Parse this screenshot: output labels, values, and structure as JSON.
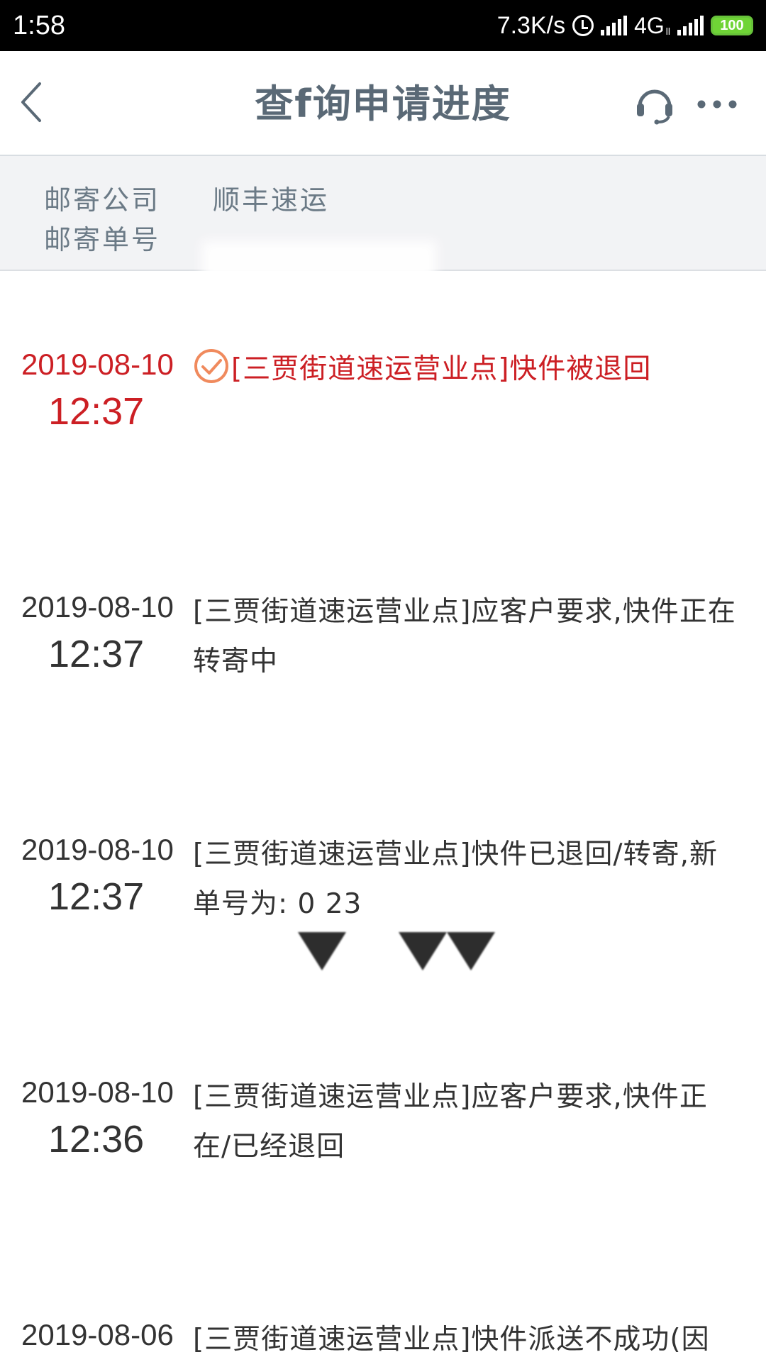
{
  "status_bar": {
    "time": "1:58",
    "net_speed": "7.3K/s",
    "network": "4G",
    "network_sub": "ll",
    "battery": "100",
    "icons": [
      "alarm-icon",
      "signal-icon",
      "signal-icon",
      "battery-icon"
    ]
  },
  "nav": {
    "title": "查f询申请进度",
    "icons": [
      "back-icon",
      "headset-icon",
      "more-icon"
    ]
  },
  "shipping": {
    "company_label": "邮寄公司",
    "company_value": "顺丰速运",
    "number_label": "邮寄单号",
    "number_value": ""
  },
  "timeline": [
    {
      "date": "2019-08-10",
      "time": "12:37",
      "text": "[三贾街道速运营业点]快件被退回",
      "latest": true
    },
    {
      "date": "2019-08-10",
      "time": "12:37",
      "text": "[三贾街道速运营业点]应客户要求,快件正在转寄中",
      "latest": false
    },
    {
      "date": "2019-08-10",
      "time": "12:37",
      "text": "[三贾街道速运营业点]快件已退回/转寄,新单号为: 0          23",
      "latest": false
    },
    {
      "date": "2019-08-10",
      "time": "12:36",
      "text": "[三贾街道速运营业点]应客户要求,快件正在/已经退回",
      "latest": false
    },
    {
      "date": "2019-08-06",
      "time": "",
      "text": "[三贾街道速运营业点]快件派送不成功(因",
      "latest": false
    }
  ],
  "colors": {
    "accent_red": "#cc1f24",
    "title_gray": "#5a6976",
    "panel_bg": "#f2f3f5",
    "check_orange": "#f08a5d",
    "battery_green": "#6fd436"
  }
}
